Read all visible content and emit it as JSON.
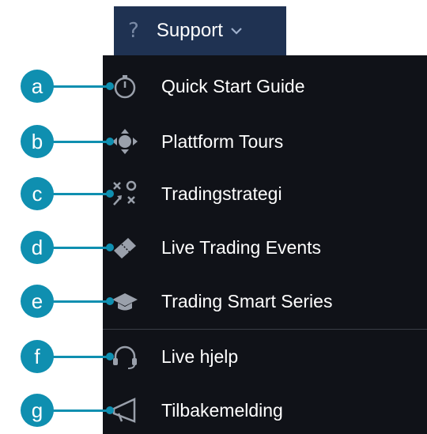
{
  "header": {
    "icon": "question-icon",
    "glyph": "?",
    "label": "Support"
  },
  "menu": {
    "items": [
      {
        "label": "Quick Start Guide",
        "icon": "stopwatch-icon",
        "callout": "a"
      },
      {
        "label": "Plattform Tours",
        "icon": "move-arrows-icon",
        "callout": "b"
      },
      {
        "label": "Tradingstrategi",
        "icon": "strategy-xo-icon",
        "callout": "c"
      },
      {
        "label": "Live Trading Events",
        "icon": "ticket-icon",
        "callout": "d"
      },
      {
        "label": "Trading Smart Series",
        "icon": "graduation-cap-icon",
        "callout": "e"
      },
      {
        "label": "Live hjelp",
        "icon": "headset-icon",
        "callout": "f"
      },
      {
        "label": "Tilbakemelding",
        "icon": "megaphone-icon",
        "callout": "g"
      }
    ]
  },
  "colors": {
    "header_bg": "#1f3252",
    "menu_bg": "#101218",
    "callout": "#0f8fb0",
    "text": "#ffffff",
    "icon": "#9aa0ab"
  }
}
